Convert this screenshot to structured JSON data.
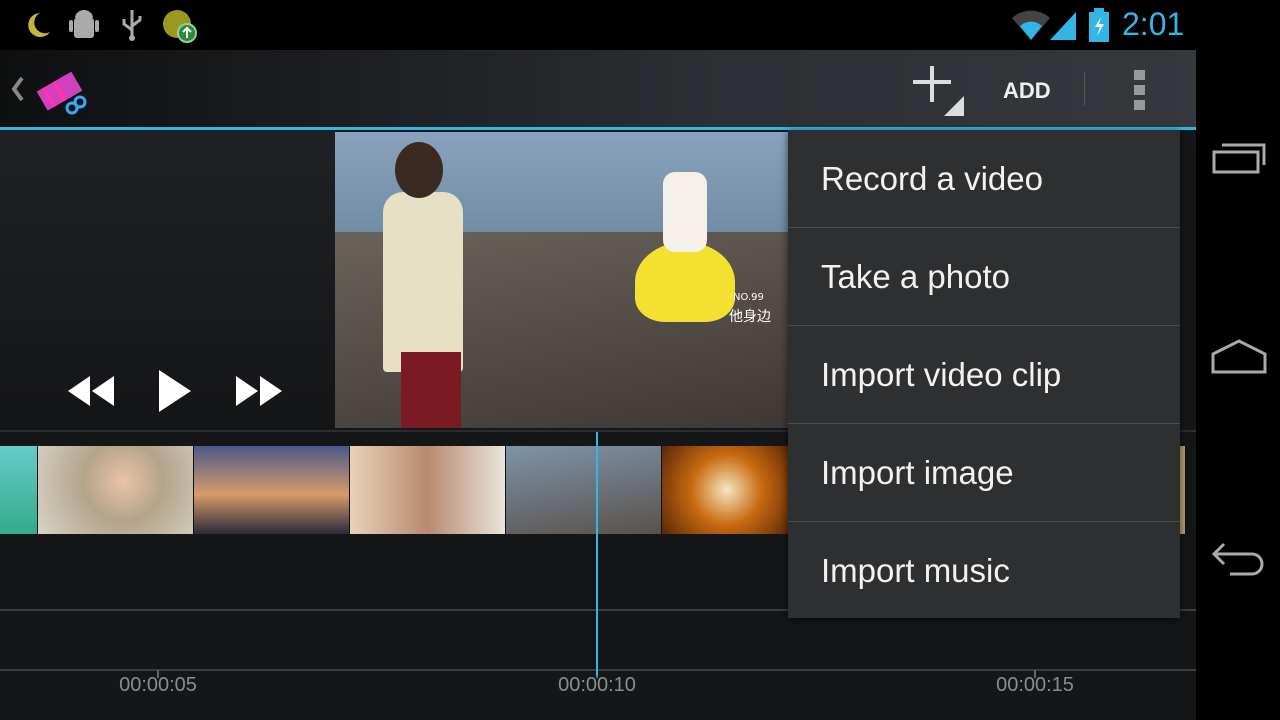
{
  "status_bar": {
    "time": "2:01",
    "icons": [
      "moon-icon",
      "android-debug-icon",
      "usb-icon",
      "update-icon",
      "wifi-icon",
      "signal-icon",
      "battery-charging-icon"
    ]
  },
  "action_bar": {
    "add_label": "ADD",
    "icons": [
      "back-chevron-icon",
      "movie-studio-app-icon",
      "add-plus-icon",
      "overflow-menu-icon"
    ]
  },
  "menu": {
    "items": [
      "Record a video",
      "Take a photo",
      "Import video clip",
      "Import image",
      "Import music"
    ]
  },
  "timeline": {
    "labels": [
      "00:00:05",
      "00:00:10",
      "00:00:15"
    ]
  },
  "video_overlay": {
    "caption1": "NO.99",
    "caption2": "他身边"
  },
  "colors": {
    "accent": "#33b5e5",
    "menu_bg": "#2e2f31"
  }
}
